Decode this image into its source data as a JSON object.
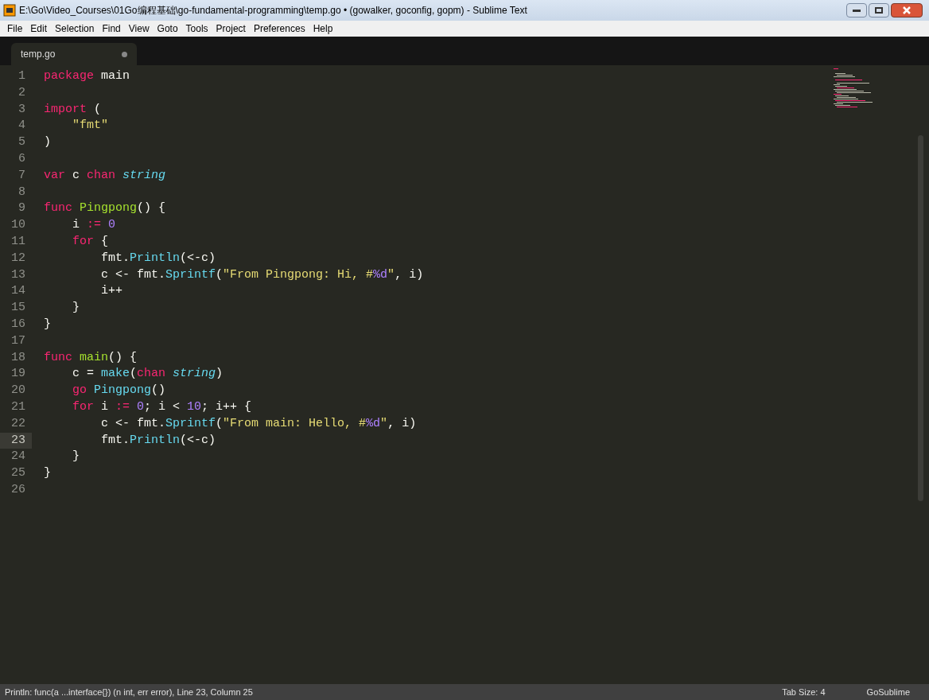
{
  "window": {
    "title": "E:\\Go\\Video_Courses\\01Go编程基础\\go-fundamental-programming\\temp.go • (gowalker, goconfig, gopm) - Sublime Text"
  },
  "menu": [
    "File",
    "Edit",
    "Selection",
    "Find",
    "View",
    "Goto",
    "Tools",
    "Project",
    "Preferences",
    "Help"
  ],
  "tabs": [
    {
      "label": "temp.go",
      "selected": true,
      "modified": true
    }
  ],
  "editor": {
    "lines": [
      {
        "number": "1",
        "current": false,
        "tokens": [
          {
            "text": "package",
            "kind": "kw"
          },
          {
            "text": " main",
            "kind": "plain"
          }
        ]
      },
      {
        "number": "2",
        "current": false
      },
      {
        "number": "3",
        "current": false,
        "tokens": [
          {
            "text": "import",
            "kind": "kw"
          },
          {
            "text": " (",
            "kind": "plain"
          }
        ]
      },
      {
        "number": "4",
        "current": false,
        "tokens": [
          {
            "text": "    \"fmt\"",
            "kind": "str"
          }
        ]
      },
      {
        "number": "5",
        "current": false,
        "tokens": [
          {
            "text": ")",
            "kind": "plain"
          }
        ]
      },
      {
        "number": "6",
        "current": false
      },
      {
        "number": "7",
        "current": false,
        "tokens": [
          {
            "text": "var",
            "kind": "kw"
          },
          {
            "text": " c ",
            "kind": "plain"
          },
          {
            "text": "chan",
            "kind": "kw"
          },
          {
            "text": " string",
            "kind": "type"
          }
        ]
      },
      {
        "number": "8",
        "current": false
      },
      {
        "number": "9",
        "current": false,
        "tokens": [
          {
            "text": "func",
            "kind": "kw"
          },
          {
            "text": " Pingpong",
            "kind": "fn"
          },
          {
            "text": "() {",
            "kind": "plain"
          }
        ]
      },
      {
        "number": "10",
        "current": false,
        "tokens": [
          {
            "text": "    i ",
            "kind": "plain"
          },
          {
            "text": ":=",
            "kind": "kw"
          },
          {
            "text": " 0",
            "kind": "num"
          }
        ]
      },
      {
        "number": "11",
        "current": false,
        "tokens": [
          {
            "text": "    for",
            "kind": "kw"
          },
          {
            "text": " {",
            "kind": "plain"
          }
        ]
      },
      {
        "number": "12",
        "current": false,
        "tokens": [
          {
            "text": "        fmt.",
            "kind": "plain"
          },
          {
            "text": "Println",
            "kind": "call"
          },
          {
            "text": "(<-c)",
            "kind": "plain"
          }
        ]
      },
      {
        "number": "13",
        "current": false,
        "tokens": [
          {
            "text": "        c <- fmt.",
            "kind": "plain"
          },
          {
            "text": "Sprintf",
            "kind": "call"
          },
          {
            "text": "(",
            "kind": "plain"
          },
          {
            "text": "\"From Pingpong: Hi, #",
            "kind": "str"
          },
          {
            "text": "%d",
            "kind": "num"
          },
          {
            "text": "\"",
            "kind": "str"
          },
          {
            "text": ", i)",
            "kind": "plain"
          }
        ]
      },
      {
        "number": "14",
        "current": false,
        "tokens": [
          {
            "text": "        i++",
            "kind": "plain"
          }
        ]
      },
      {
        "number": "15",
        "current": false,
        "tokens": [
          {
            "text": "    }",
            "kind": "plain"
          }
        ]
      },
      {
        "number": "16",
        "current": false,
        "tokens": [
          {
            "text": "}",
            "kind": "plain"
          }
        ]
      },
      {
        "number": "17",
        "current": false
      },
      {
        "number": "18",
        "current": false,
        "tokens": [
          {
            "text": "func",
            "kind": "kw"
          },
          {
            "text": " main",
            "kind": "fn"
          },
          {
            "text": "() {",
            "kind": "plain"
          }
        ]
      },
      {
        "number": "19",
        "current": false,
        "tokens": [
          {
            "text": "    c = ",
            "kind": "plain"
          },
          {
            "text": "make",
            "kind": "call"
          },
          {
            "text": "(",
            "kind": "plain"
          },
          {
            "text": "chan",
            "kind": "kw"
          },
          {
            "text": " string",
            "kind": "type"
          },
          {
            "text": ")",
            "kind": "plain"
          }
        ]
      },
      {
        "number": "20",
        "current": false,
        "tokens": [
          {
            "text": "    go",
            "kind": "kw"
          },
          {
            "text": " Pingpong",
            "kind": "call"
          },
          {
            "text": "()",
            "kind": "plain"
          }
        ]
      },
      {
        "number": "21",
        "current": false,
        "tokens": [
          {
            "text": "    for",
            "kind": "kw"
          },
          {
            "text": " i ",
            "kind": "plain"
          },
          {
            "text": ":=",
            "kind": "kw"
          },
          {
            "text": " 0",
            "kind": "num"
          },
          {
            "text": "; i < ",
            "kind": "plain"
          },
          {
            "text": "10",
            "kind": "num"
          },
          {
            "text": "; i++ {",
            "kind": "plain"
          }
        ]
      },
      {
        "number": "22",
        "current": false,
        "tokens": [
          {
            "text": "        c <- fmt.",
            "kind": "plain"
          },
          {
            "text": "Sprintf",
            "kind": "call"
          },
          {
            "text": "(",
            "kind": "plain"
          },
          {
            "text": "\"From main: Hello, #",
            "kind": "str"
          },
          {
            "text": "%d",
            "kind": "num"
          },
          {
            "text": "\"",
            "kind": "str"
          },
          {
            "text": ", i)",
            "kind": "plain"
          }
        ]
      },
      {
        "number": "23",
        "current": true,
        "tokens": [
          {
            "text": "        fmt.",
            "kind": "plain"
          },
          {
            "text": "Println",
            "kind": "call"
          },
          {
            "text": "(<-c)",
            "kind": "plain"
          }
        ]
      },
      {
        "number": "24",
        "current": false,
        "tokens": [
          {
            "text": "    }",
            "kind": "plain"
          }
        ]
      },
      {
        "number": "25",
        "current": false,
        "tokens": [
          {
            "text": "}",
            "kind": "plain"
          }
        ]
      },
      {
        "number": "26",
        "current": false
      }
    ]
  },
  "status_bar": {
    "message": "Println: func(a ...interface{}) (n int, err error), Line 23, Column 25",
    "tab_size": "Tab Size: 4",
    "syntax": "GoSublime"
  }
}
